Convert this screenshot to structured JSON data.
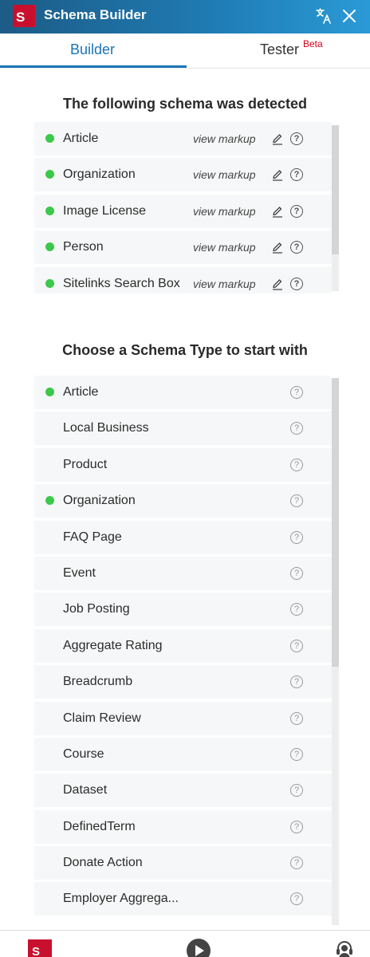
{
  "header": {
    "logo_letter": "S",
    "title": "Schema Builder",
    "translate_icon": "translate-icon",
    "close_icon": "close-icon"
  },
  "tabs": {
    "builder": "Builder",
    "tester": "Tester",
    "tester_badge": "Beta"
  },
  "detected": {
    "title": "The following schema was detected",
    "view_label": "view markup",
    "items": [
      {
        "label": "Article"
      },
      {
        "label": "Organization"
      },
      {
        "label": "Image License"
      },
      {
        "label": "Person"
      },
      {
        "label": "Sitelinks Search Box"
      }
    ]
  },
  "types": {
    "title": "Choose a Schema Type to start with",
    "items": [
      {
        "label": "Article",
        "active": true
      },
      {
        "label": "Local Business",
        "active": false
      },
      {
        "label": "Product",
        "active": false
      },
      {
        "label": "Organization",
        "active": true
      },
      {
        "label": "FAQ Page",
        "active": false
      },
      {
        "label": "Event",
        "active": false
      },
      {
        "label": "Job Posting",
        "active": false
      },
      {
        "label": "Aggregate Rating",
        "active": false
      },
      {
        "label": "Breadcrumb",
        "active": false
      },
      {
        "label": "Claim Review",
        "active": false
      },
      {
        "label": "Course",
        "active": false
      },
      {
        "label": "Dataset",
        "active": false
      },
      {
        "label": "DefinedTerm",
        "active": false
      },
      {
        "label": "Donate Action",
        "active": false
      },
      {
        "label": "Employer Aggrega...",
        "active": false
      }
    ]
  },
  "footer": {
    "logo_letter": "S"
  },
  "colors": {
    "accent": "#1b74b8",
    "status_green": "#3cc84a",
    "brand_red": "#c8102e",
    "beta_red": "#d0021b"
  }
}
